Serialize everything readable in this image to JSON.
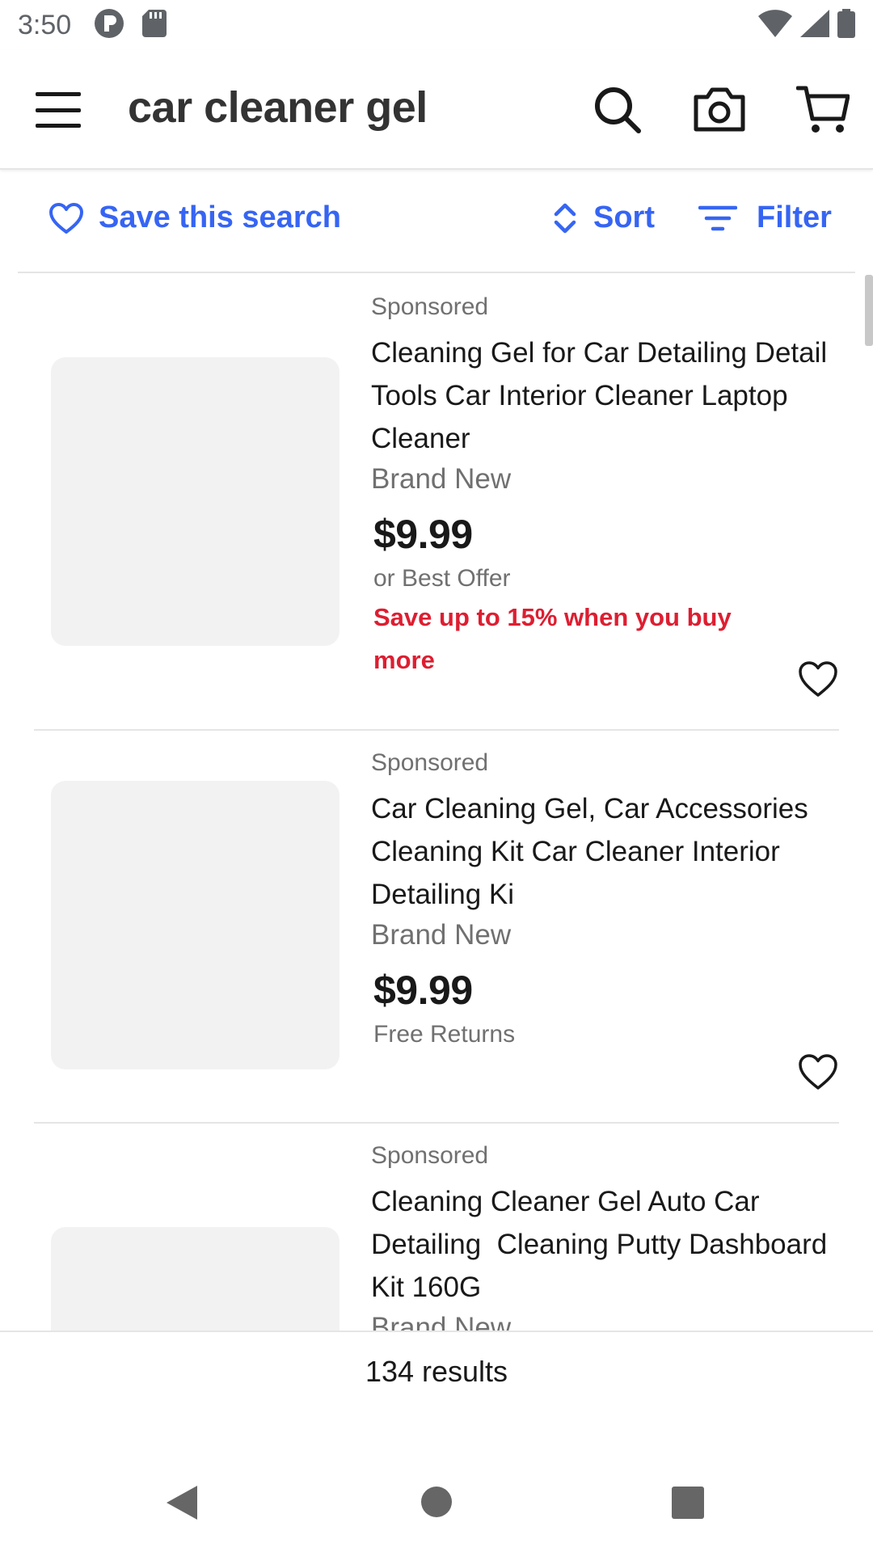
{
  "status": {
    "time": "3:50",
    "icons": [
      "vpn-icon",
      "sd-card-icon",
      "wifi-icon",
      "signal-icon",
      "battery-icon"
    ]
  },
  "header": {
    "query": "car cleaner gel",
    "icons": [
      "menu-icon",
      "search-icon",
      "camera-icon",
      "cart-icon"
    ]
  },
  "toolbar": {
    "save_search": "Save this search",
    "sort": "Sort",
    "filter": "Filter"
  },
  "items": [
    {
      "sponsored": "Sponsored",
      "title": "Cleaning Gel for Car Detailing Detail Tools Car Interior Cleaner Laptop Cleaner",
      "condition": "Brand New",
      "price": "$9.99",
      "sub": "or Best Offer",
      "promo": "Save up to 15% when you buy more"
    },
    {
      "sponsored": "Sponsored",
      "title": "Car Cleaning Gel, Car Accessories Cleaning Kit Car Cleaner Interior Detailing Ki",
      "condition": "Brand New",
      "price": "$9.99",
      "sub": "Free Returns"
    },
    {
      "sponsored": "Sponsored",
      "title": "Cleaning Cleaner Gel Auto Car Detailing  Cleaning Putty Dashboard Kit 160G",
      "condition": "Brand New"
    }
  ],
  "results_count": "134 results",
  "colors": {
    "accent": "#3665f3",
    "promo": "#dd1e31",
    "text": "#191919",
    "muted": "#707070"
  }
}
